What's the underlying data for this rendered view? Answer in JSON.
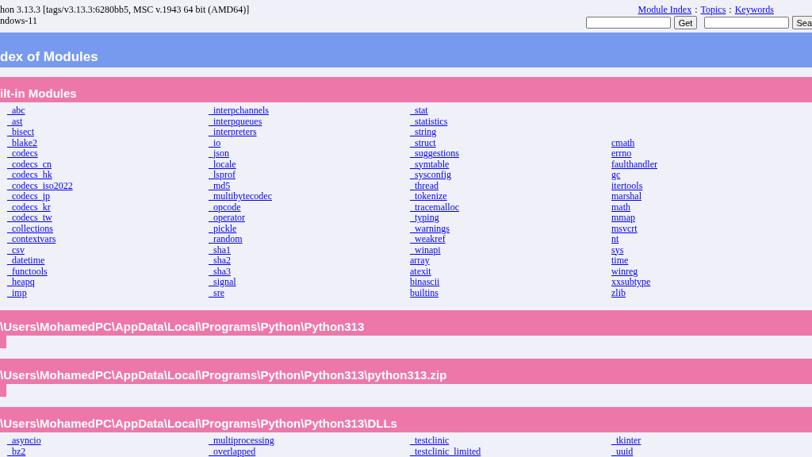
{
  "header": {
    "version_line": "hon 3.13.3 [tags/v3.13.3:6280bb5, MSC v.1943 64 bit (AMD64)]",
    "platform": "ndows-11",
    "links": [
      "Module Index",
      "Topics",
      "Keywords"
    ],
    "separator": ":",
    "get_button": "Get",
    "search_button": "Sea"
  },
  "title": "dex of Modules",
  "sections": [
    {
      "heading": "ilt-in Modules",
      "columns": [
        [
          "_abc",
          "_ast",
          "_bisect",
          "_blake2",
          "_codecs",
          "_codecs_cn",
          "_codecs_hk",
          "_codecs_iso2022",
          "_codecs_jp",
          "_codecs_kr",
          "_codecs_tw",
          "_collections",
          "_contextvars",
          "_csv",
          "_datetime",
          "_functools",
          "_heapq",
          "_imp"
        ],
        [
          "_interpchannels",
          "_interpqueues",
          "_interpreters",
          "_io",
          "_json",
          "_locale",
          "_lsprof",
          "_md5",
          "_multibytecodec",
          "_opcode",
          "_operator",
          "_pickle",
          "_random",
          "_sha1",
          "_sha2",
          "_sha3",
          "_signal",
          "_sre"
        ],
        [
          "_stat",
          "_statistics",
          "_string",
          "_struct",
          "_suggestions",
          "_symtable",
          "_sysconfig",
          "_thread",
          "_tokenize",
          "_tracemalloc",
          "_typing",
          "_warnings",
          "_weakref",
          "_winapi",
          "array",
          "atexit",
          "binascii",
          "builtins"
        ],
        [
          "cmath",
          "errno",
          "faulthandler",
          "gc",
          "itertools",
          "marshal",
          "math",
          "mmap",
          "msvcrt",
          "nt",
          "sys",
          "time",
          "winreg",
          "xxsubtype",
          "zlib"
        ]
      ]
    },
    {
      "heading": "\\Users\\MohamedPC\\AppData\\Local\\Programs\\Python\\Python313"
    },
    {
      "heading": "\\Users\\MohamedPC\\AppData\\Local\\Programs\\Python\\Python313\\python313.zip"
    },
    {
      "heading": "\\Users\\MohamedPC\\AppData\\Local\\Programs\\Python\\Python313\\DLLs",
      "columns": [
        [
          "_asyncio",
          "_bz2"
        ],
        [
          "_multiprocessing",
          "_overlapped"
        ],
        [
          "_testclinic",
          "_testclinic_limited"
        ],
        [
          "_tkinter",
          "_uuid"
        ]
      ]
    }
  ]
}
